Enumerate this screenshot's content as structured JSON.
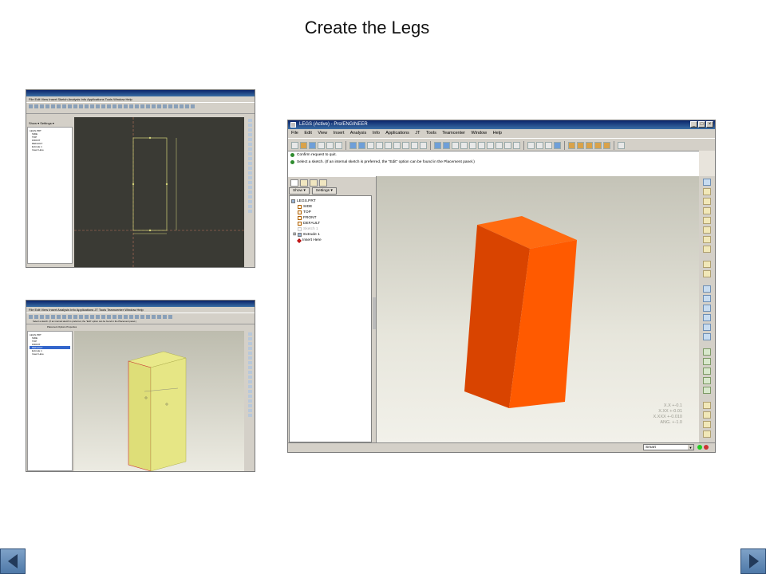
{
  "slide": {
    "title": "Create the Legs"
  },
  "main_window": {
    "title": "LEGS (Active) - Pro/ENGINEER",
    "menu": [
      "File",
      "Edit",
      "View",
      "Insert",
      "Analysis",
      "Info",
      "Applications",
      "JT",
      "Tools",
      "Teamcenter",
      "Window",
      "Help"
    ],
    "messages": [
      "Confirm request to quit.",
      "Select a sketch. (If an internal sketch is preferred, the \"Edit\" option can be found in the Placement panel.)"
    ],
    "nav_buttons": {
      "show": "Show ▾",
      "settings": "Settings ▾"
    },
    "tree": [
      {
        "label": "LEGS.PRT",
        "icon": "part-icon",
        "indent": 0,
        "dim": false
      },
      {
        "label": "SIDE",
        "icon": "datum-plane-icon",
        "indent": 1,
        "dim": false
      },
      {
        "label": "TOP",
        "icon": "datum-plane-icon",
        "indent": 1,
        "dim": false
      },
      {
        "label": "FRONT",
        "icon": "datum-plane-icon",
        "indent": 1,
        "dim": false
      },
      {
        "label": "DEFAULT",
        "icon": "coordinate-system-icon",
        "indent": 1,
        "dim": false
      },
      {
        "label": "Sketch 1",
        "icon": "sketch-icon",
        "indent": 1,
        "dim": true
      },
      {
        "label": "Extrude 1",
        "icon": "extrude-icon",
        "indent": 1,
        "dim": false
      },
      {
        "label": "Insert Here",
        "icon": "insert-here-icon",
        "indent": 1,
        "dim": false
      }
    ],
    "tolerances": [
      "X.X +-0.1",
      "X.XX +-0.01",
      "X.XXX +-0.010",
      "ANG. +-1.0"
    ],
    "filter_value": "Smart",
    "colors": {
      "solid_front": "#ff5a00",
      "solid_side": "#d94400",
      "solid_top": "#ff6a10",
      "sketch_yellow": "#d7d77a"
    }
  },
  "sketch_window": {
    "menu_text": "File Edit View Insert Sketch Analysis Info Applications Tools Window Help",
    "tabs": "Show ▾  Settings ▾",
    "tree": [
      "LEGS.PRT",
      "SIDE",
      "TOP",
      "FRONT",
      "DEFAULT",
      "Extrude 1",
      "Insert Here"
    ]
  },
  "extrude_window": {
    "menu_text": "File Edit View Insert Analysis Info Applications JT Tools Teamcenter Window Help",
    "message": "Select a sketch. (If an internal sketch is preferred, the \"Edit\" option can be found in the Placement panel.)",
    "panels": "Placement  Options  Properties",
    "tree": [
      "LEGS.PRT",
      "SIDE",
      "TOP",
      "FRONT",
      "DEFAULT",
      "Extrude 1",
      "Insert Here"
    ]
  },
  "nav": {
    "prev_icon": "left-arrow-icon",
    "next_icon": "right-arrow-icon"
  }
}
